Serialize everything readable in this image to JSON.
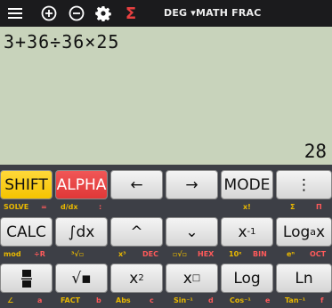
{
  "topbar": {
    "menu_icon": "hamburger-menu-icon",
    "add_icon": "plus-circle-icon",
    "remove_icon": "minus-circle-icon",
    "settings_icon": "gear-icon",
    "sigma_icon": "sigma-icon",
    "modes": "DEG ▾MATH FRAC"
  },
  "display": {
    "expression": "3+36÷36×25",
    "result": "28"
  },
  "keys": {
    "shift": "SHIFT",
    "alpha": "ALPHA",
    "left": "←",
    "right": "→",
    "mode": "MODE",
    "more": "⋮",
    "calc": "CALC",
    "integral": "∫dx",
    "up": "^",
    "down": "⌄",
    "inverse_base": "x",
    "inverse_exp": "-1",
    "log_a_x": "Log",
    "log_a_sub": "a",
    "log_a_x2": "x",
    "fraction": "▪▪",
    "sqrt": "√▪",
    "square_base": "x",
    "square_exp": "2",
    "power_base": "x",
    "power_exp": "□",
    "log": "Log",
    "ln": "Ln"
  },
  "secondary": {
    "row1": [
      {
        "t": "SOLVE",
        "c": "y"
      },
      {
        "t": "=",
        "c": "r"
      },
      {
        "t": "d/dx",
        "c": "y"
      },
      {
        "t": ":",
        "c": "r"
      },
      {
        "t": "x!",
        "c": "y"
      },
      {
        "t": "Σ",
        "c": "y"
      },
      {
        "t": "Π",
        "c": "r"
      }
    ],
    "row2": [
      {
        "t": "mod",
        "c": "y"
      },
      {
        "t": "÷R",
        "c": "r"
      },
      {
        "t": "³√▫",
        "c": "y"
      },
      {
        "t": "x³",
        "c": "y"
      },
      {
        "t": "DEC",
        "c": "r"
      },
      {
        "t": "▫√▫",
        "c": "y"
      },
      {
        "t": "HEX",
        "c": "r"
      },
      {
        "t": "10ˣ",
        "c": "y"
      },
      {
        "t": "BIN",
        "c": "r"
      },
      {
        "t": "eⁿ",
        "c": "y"
      },
      {
        "t": "OCT",
        "c": "r"
      }
    ],
    "row3": [
      {
        "t": "∠",
        "c": "y"
      },
      {
        "t": "a",
        "c": "r"
      },
      {
        "t": "FACT",
        "c": "y"
      },
      {
        "t": "b",
        "c": "r"
      },
      {
        "t": "Abs",
        "c": "y"
      },
      {
        "t": "c",
        "c": "r"
      },
      {
        "t": "Sin⁻¹",
        "c": "y"
      },
      {
        "t": "d",
        "c": "r"
      },
      {
        "t": "Cos⁻¹",
        "c": "y"
      },
      {
        "t": "e",
        "c": "r"
      },
      {
        "t": "Tan⁻¹",
        "c": "y"
      },
      {
        "t": "f",
        "c": "r"
      }
    ]
  }
}
